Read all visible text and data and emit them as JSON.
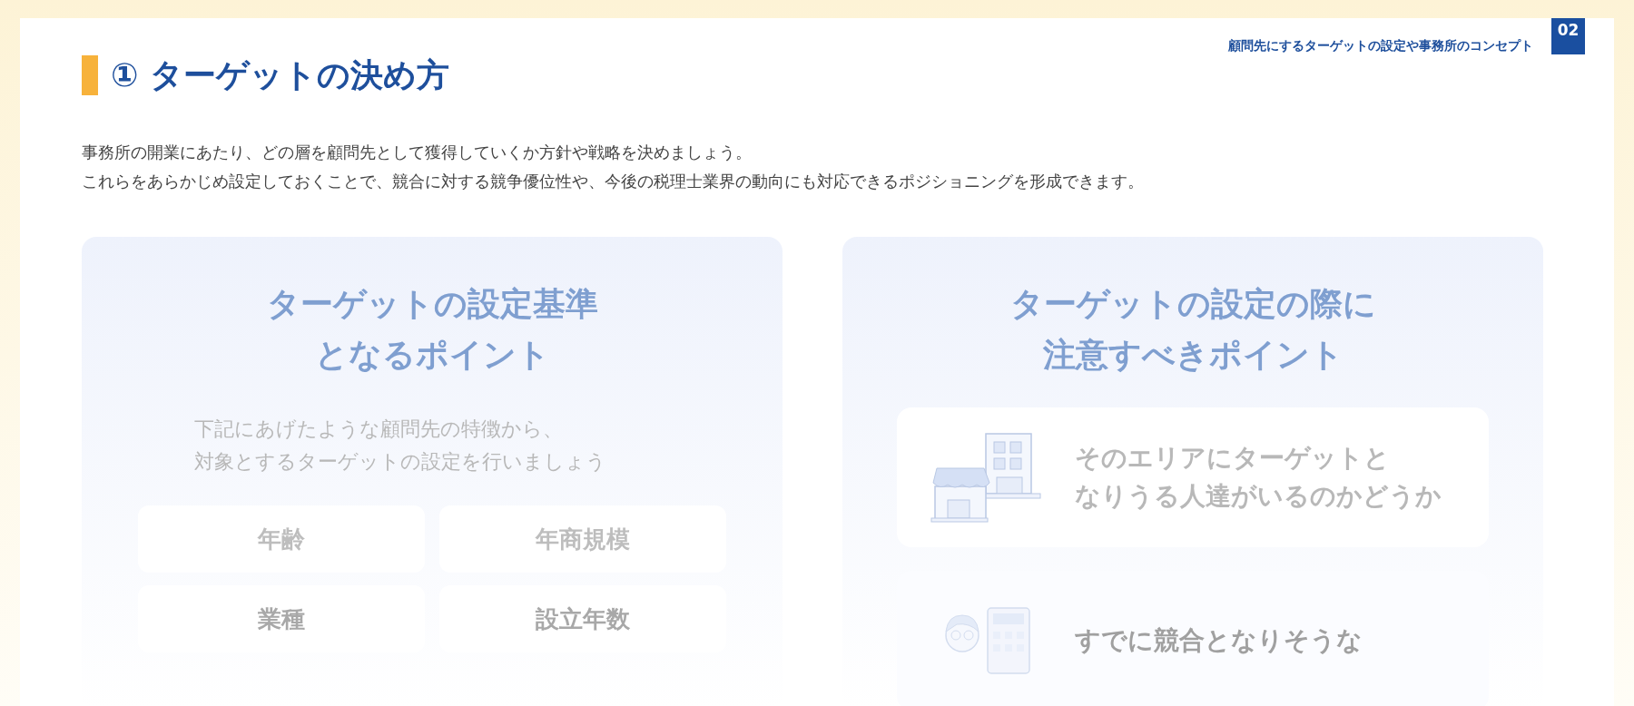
{
  "header": {
    "section_title": "顧問先にするターゲットの設定や事務所のコンセプト",
    "page_number": "02"
  },
  "title": "① ターゲットの決め方",
  "intro": [
    "事務所の開業にあたり、どの層を顧問先として獲得していくか方針や戦略を決めましょう。",
    "これらをあらかじめ設定しておくことで、競合に対する競争優位性や、今後の税理士業界の動向にも対応できるポジショニングを形成できます。"
  ],
  "criteria_panel": {
    "title_lines": [
      "ターゲットの設定基準",
      "となるポイント"
    ],
    "subtitle_lines": [
      "下記にあげたような顧問先の特徴から、",
      "対象とするターゲットの設定を行いましょう"
    ],
    "criteria": [
      "年齢",
      "年商規模",
      "業種",
      "設立年数"
    ]
  },
  "caution_panel": {
    "title_lines": [
      "ターゲットの設定の際に",
      "注意すべきポイント"
    ],
    "points": [
      {
        "kind": "area",
        "lines": [
          "そのエリアにターゲットと",
          "なりうる人達がいるのかどうか"
        ]
      },
      {
        "kind": "competitor",
        "lines": [
          "すでに競合となりそうな"
        ]
      }
    ]
  }
}
